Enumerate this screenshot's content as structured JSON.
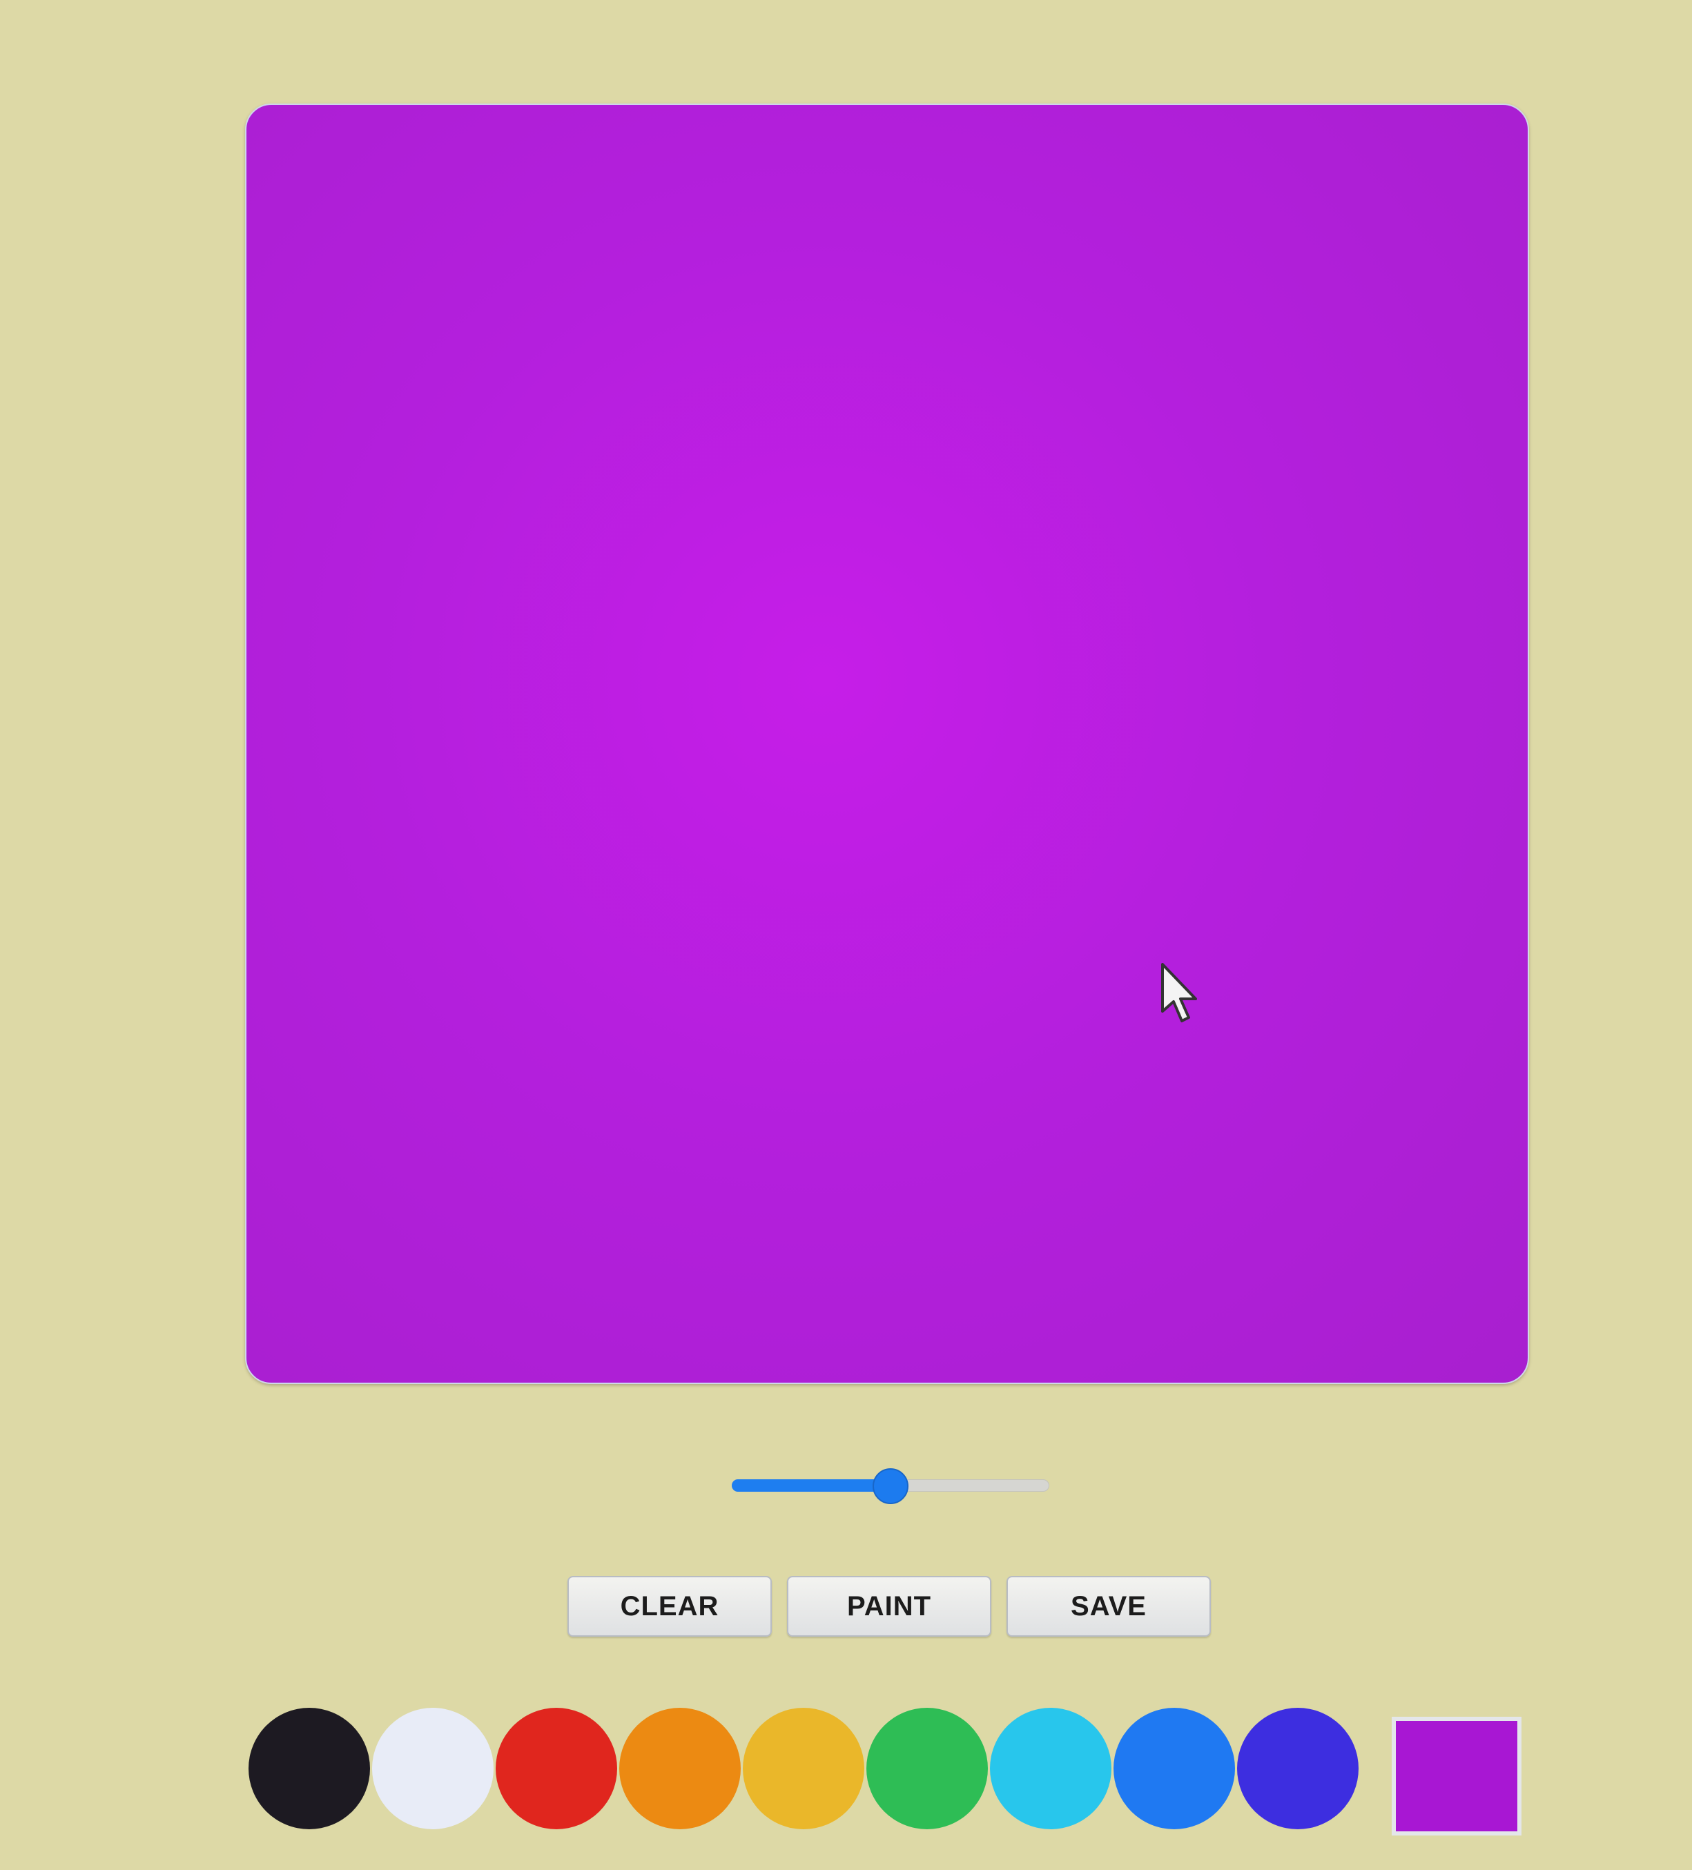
{
  "canvas": {
    "fill_color": "#b41fdd"
  },
  "brush_size": {
    "value_fraction": 0.5
  },
  "toolbar": {
    "clear_label": "CLEAR",
    "paint_label": "PAINT",
    "save_label": "SAVE"
  },
  "palette": {
    "colors": [
      {
        "name": "black",
        "hex": "#1d1a22"
      },
      {
        "name": "white",
        "hex": "#e8ecf7"
      },
      {
        "name": "red",
        "hex": "#e0261e"
      },
      {
        "name": "orange",
        "hex": "#ec8a12"
      },
      {
        "name": "yellow",
        "hex": "#eab72a"
      },
      {
        "name": "green",
        "hex": "#2ebd55"
      },
      {
        "name": "cyan",
        "hex": "#28c6ec"
      },
      {
        "name": "blue",
        "hex": "#1f79f2"
      },
      {
        "name": "indigo",
        "hex": "#3d2ee0"
      }
    ],
    "current_color": "#a817d3"
  },
  "cursor": {
    "icon": "arrow-pointer-icon"
  }
}
